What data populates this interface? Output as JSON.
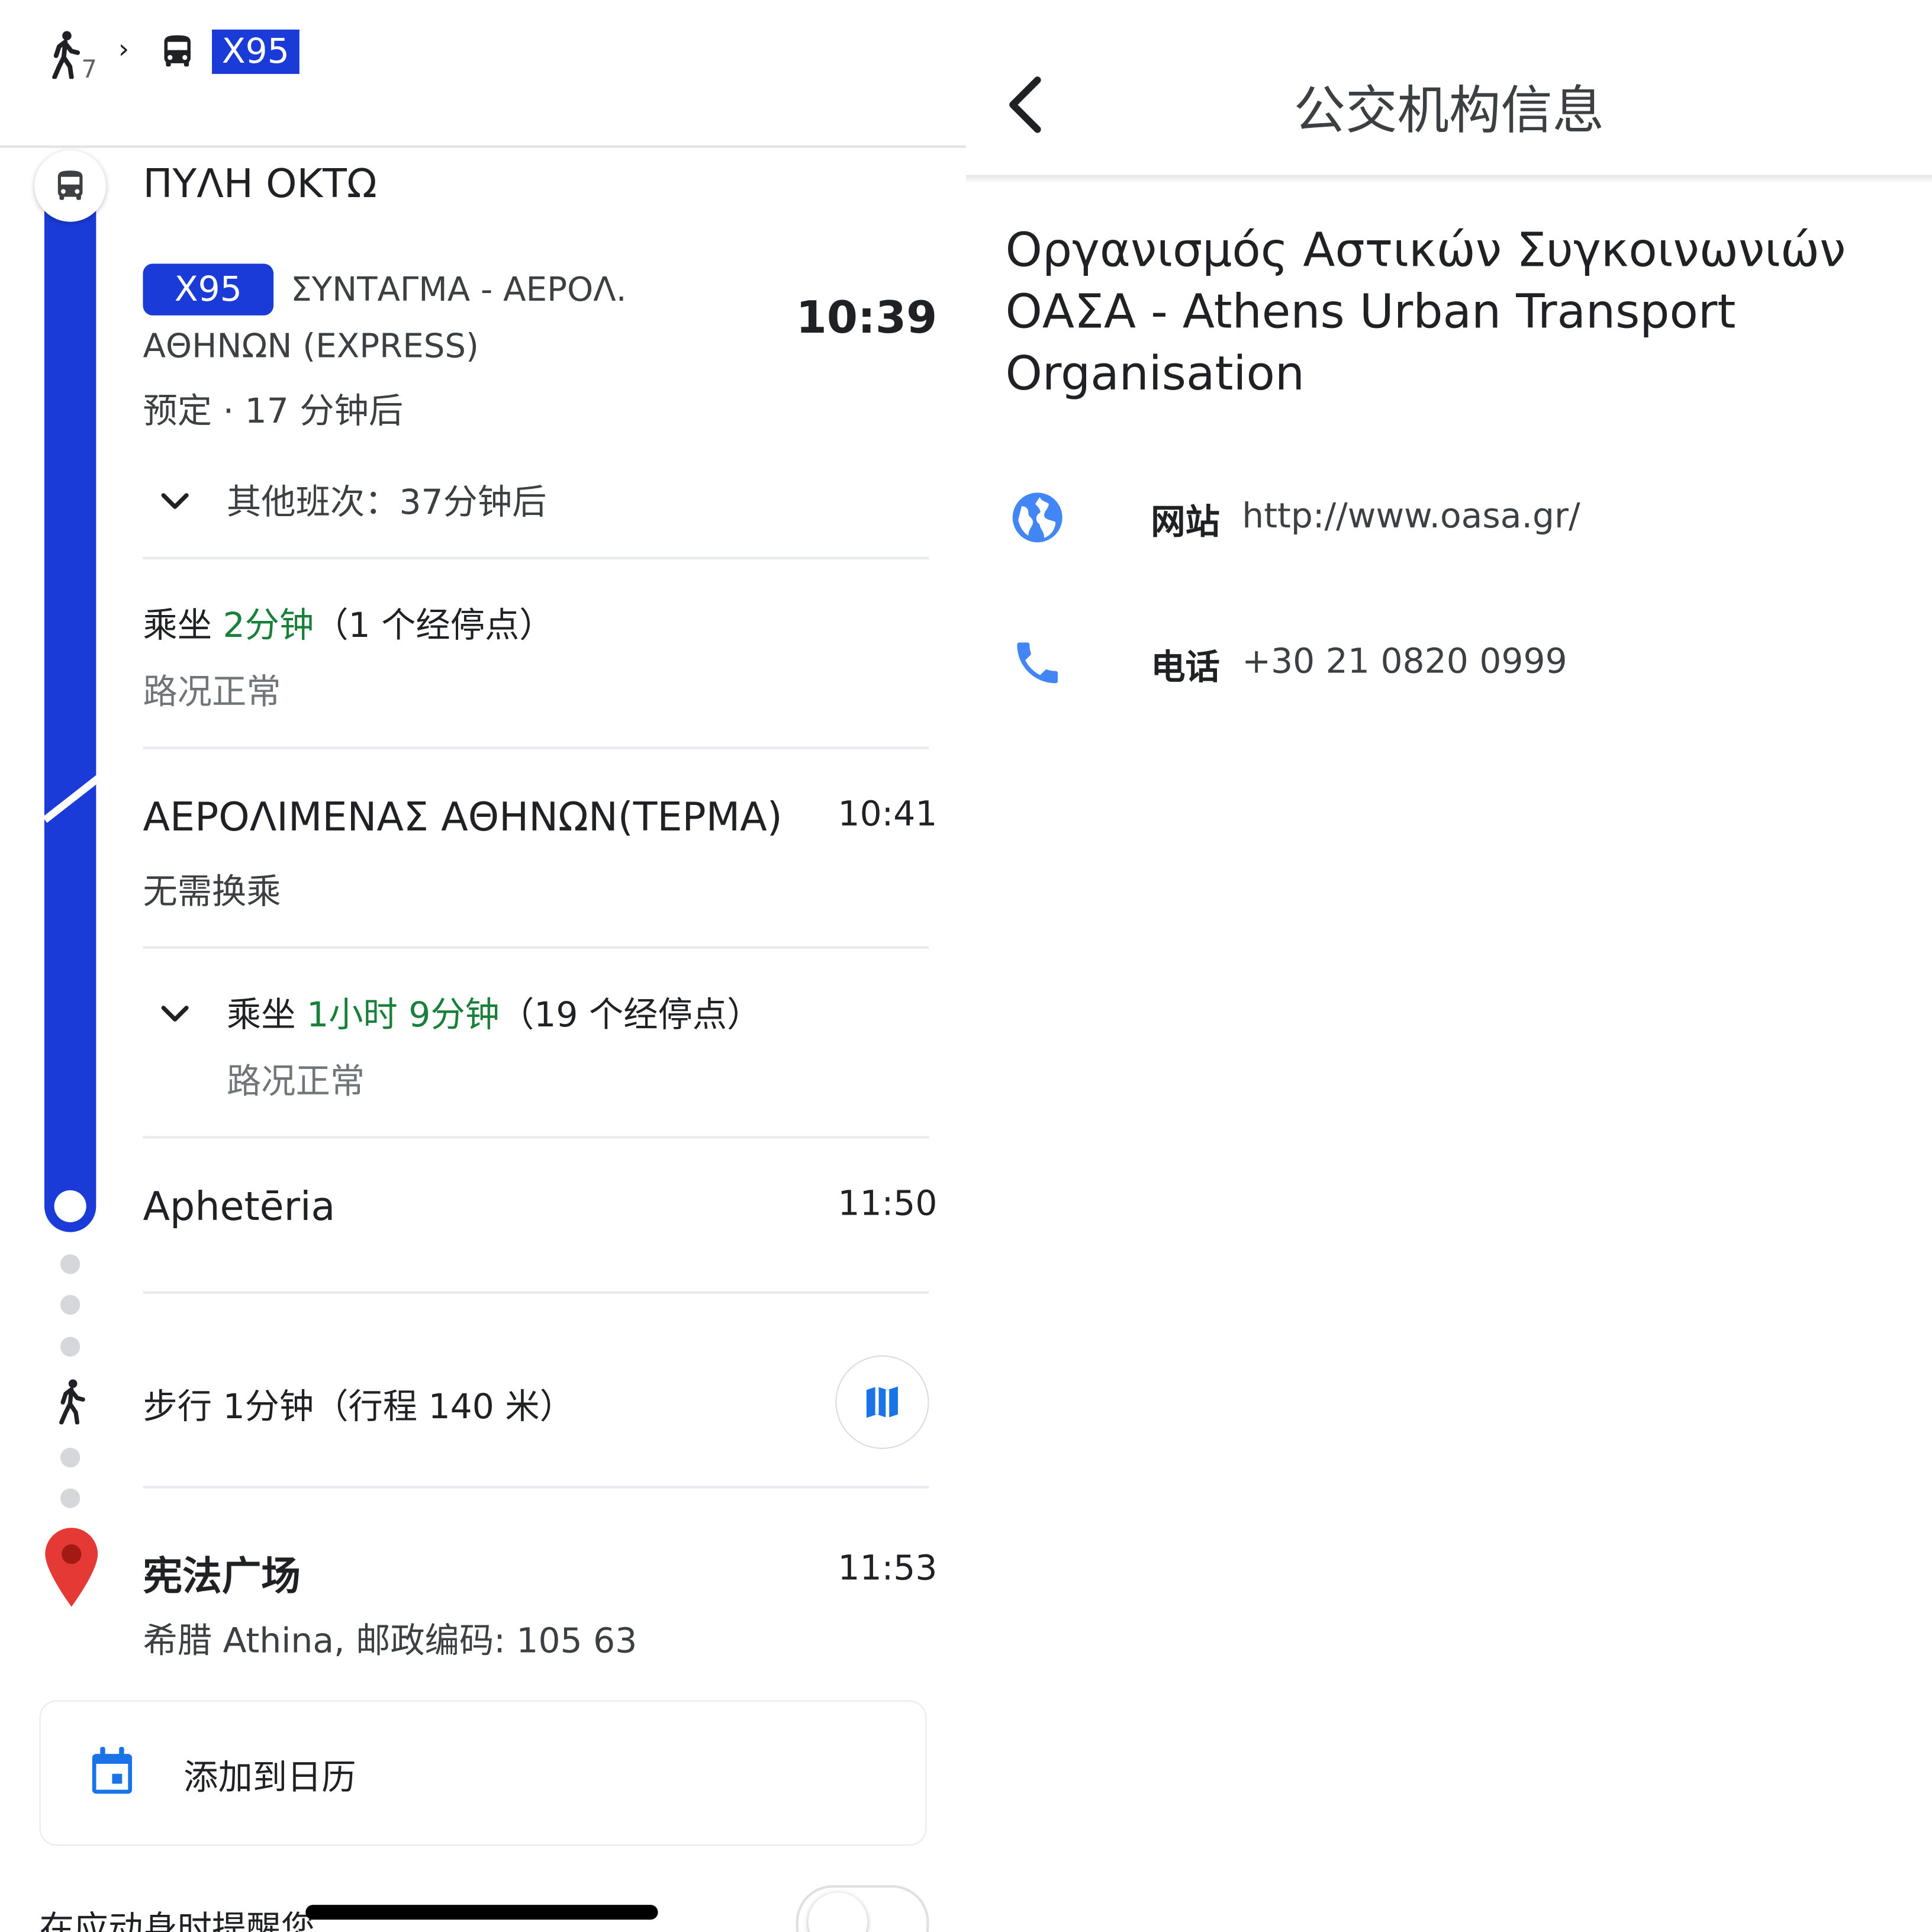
{
  "summary": {
    "walk_minutes": "7",
    "chevron": "›",
    "line_badge": "X95"
  },
  "route": {
    "origin_stop": "ΠΥΛΗ ΟΚΤΩ",
    "line": {
      "badge": "X95",
      "destination_line1": "ΣΥΝΤΑΓΜΑ - ΑΕΡΟΛ.",
      "destination_line2": "ΑΘΗΝΩΝ (EXPRESS)",
      "departure_time": "10:39",
      "schedule_status": "预定 · 17 分钟后",
      "other_departures": "其他班次：37分钟后"
    },
    "ride1": {
      "prefix": "乘坐 ",
      "duration": "2分钟",
      "suffix": "（1 个经停点）",
      "traffic": "路况正常"
    },
    "transfer_stop": {
      "name": "ΑΕΡΟΛΙΜΕΝΑΣ ΑΘΗΝΩΝ(ΤΕΡΜΑ)",
      "time": "10:41",
      "note": "无需换乘"
    },
    "ride2": {
      "prefix": "乘坐 ",
      "duration": "1小时 9分钟",
      "suffix": "（19 个经停点）",
      "traffic": "路况正常"
    },
    "alight_stop": {
      "name": "Aphetēria",
      "time": "11:50"
    },
    "walk": {
      "text": "步行 1分钟（行程 140 米）"
    },
    "destination": {
      "name": "宪法广场",
      "time": "11:53",
      "address": "希腊 Athina, 邮政编码: 105 63"
    },
    "calendar": {
      "label": "添加到日历"
    },
    "reminder": {
      "label": "在应动身时提醒您"
    }
  },
  "agency_panel": {
    "title": "公交机构信息",
    "agency_name": "Οργανισμός Αστικών Συγκοινωνιών ΟΑΣΑ - Athens Urban Transport Organisation",
    "website": {
      "label": "网站",
      "value": "http://www.oasa.gr/"
    },
    "phone": {
      "label": "电话",
      "value": "+30 21 0820 0999"
    }
  },
  "colors": {
    "transit_blue": "#1a3bd8",
    "green_duration": "#188038",
    "pin_red": "#e53935",
    "icon_blue": "#4285f4"
  },
  "icons": {
    "walk": "walk-icon",
    "bus": "bus-icon",
    "map": "map-icon",
    "calendar": "calendar-icon",
    "globe": "globe-icon",
    "phone": "phone-icon",
    "pin": "pin-icon",
    "back": "back-arrow-icon",
    "expand": "chevron-down-icon"
  }
}
